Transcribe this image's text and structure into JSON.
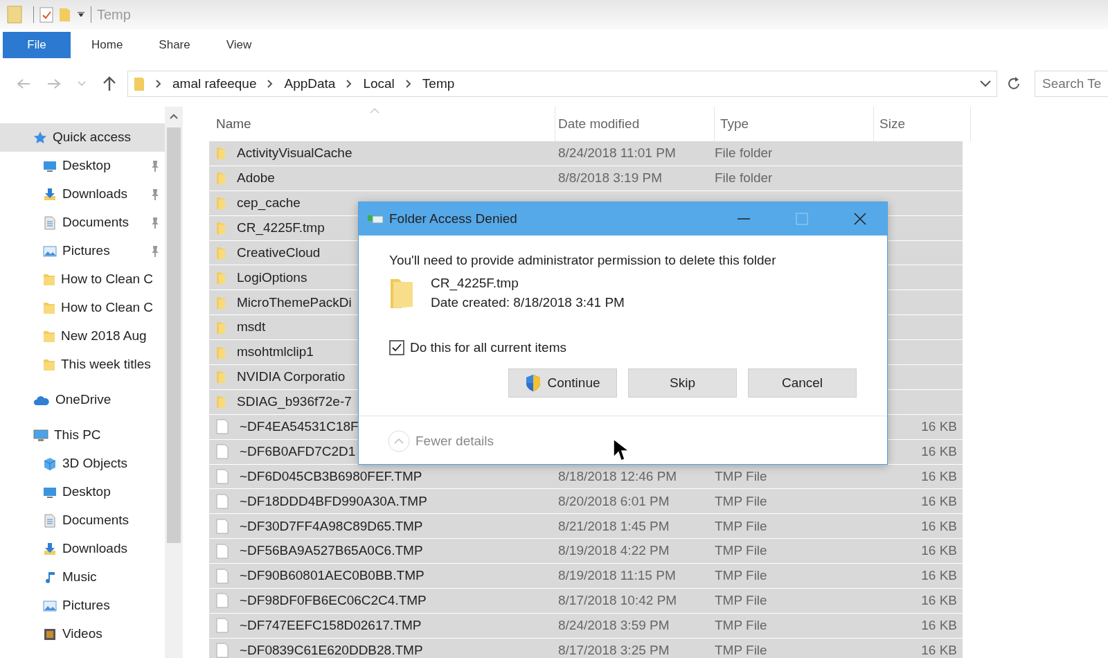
{
  "window": {
    "title": "Temp"
  },
  "ribbon_tabs": [
    {
      "label": "File",
      "selected": true
    },
    {
      "label": "Home",
      "selected": false
    },
    {
      "label": "Share",
      "selected": false
    },
    {
      "label": "View",
      "selected": false
    }
  ],
  "address_bar": {
    "path": [
      "amal rafeeque",
      "AppData",
      "Local",
      "Temp"
    ]
  },
  "search": {
    "placeholder": "Search Te"
  },
  "sidebar": {
    "items": [
      {
        "label": "Quick access",
        "kind": "star",
        "selected": true,
        "children": [
          {
            "label": "Desktop",
            "kind": "desktop",
            "selected": false,
            "pinned": true
          },
          {
            "label": "Downloads",
            "kind": "download",
            "selected": false,
            "pinned": true
          },
          {
            "label": "Documents",
            "kind": "document",
            "selected": false,
            "pinned": true
          },
          {
            "label": "Pictures",
            "kind": "picture",
            "selected": false,
            "pinned": true
          },
          {
            "label": "How to Clean C",
            "kind": "folder",
            "selected": false,
            "pinned": false
          },
          {
            "label": "How to Clean C",
            "kind": "folder",
            "selected": false,
            "pinned": false
          },
          {
            "label": "New 2018 Aug",
            "kind": "folder",
            "selected": false,
            "pinned": false
          },
          {
            "label": "This week titles",
            "kind": "folder",
            "selected": false,
            "pinned": false
          }
        ]
      },
      {
        "label": "OneDrive",
        "kind": "cloud",
        "selected": false
      },
      {
        "label": "This PC",
        "kind": "computer",
        "selected": false,
        "children": [
          {
            "label": "3D Objects",
            "kind": "cube",
            "selected": false
          },
          {
            "label": "Desktop",
            "kind": "desktop",
            "selected": false
          },
          {
            "label": "Documents",
            "kind": "document",
            "selected": false
          },
          {
            "label": "Downloads",
            "kind": "download",
            "selected": false
          },
          {
            "label": "Music",
            "kind": "music",
            "selected": false
          },
          {
            "label": "Pictures",
            "kind": "picture",
            "selected": false
          },
          {
            "label": "Videos",
            "kind": "video",
            "selected": false
          }
        ]
      }
    ]
  },
  "table": {
    "columns": [
      "Name",
      "Date modified",
      "Type",
      "Size"
    ],
    "rows": [
      {
        "kind": "folder",
        "selected": true,
        "name": "ActivityVisualCache",
        "date": "8/24/2018 11:01 PM",
        "type": "File folder"
      },
      {
        "kind": "folder",
        "selected": true,
        "name": "Adobe",
        "date": "8/8/2018 3:19 PM",
        "type": "File folder"
      },
      {
        "kind": "folder",
        "selected": true,
        "name": "cep_cache"
      },
      {
        "kind": "folder",
        "selected": true,
        "name": "CR_4225F.tmp"
      },
      {
        "kind": "folder",
        "selected": true,
        "name": "CreativeCloud"
      },
      {
        "kind": "folder",
        "selected": true,
        "name": "LogiOptions"
      },
      {
        "kind": "folder",
        "selected": true,
        "name": "MicroThemePackDi"
      },
      {
        "kind": "folder",
        "selected": true,
        "name": "msdt"
      },
      {
        "kind": "folder",
        "selected": true,
        "name": "msohtmlclip1"
      },
      {
        "kind": "folder",
        "selected": true,
        "name": "NVIDIA Corporatio"
      },
      {
        "kind": "folder",
        "selected": true,
        "name": "SDIAG_b936f72e-7"
      },
      {
        "kind": "file",
        "selected": true,
        "name": "~DF4EA54531C18F",
        "size": "16 KB"
      },
      {
        "kind": "file",
        "selected": true,
        "name": "~DF6B0AFD7C2D1",
        "size": "16 KB"
      },
      {
        "kind": "file",
        "selected": true,
        "name": "~DF6D045CB3B6980FEF.TMP",
        "date": "8/18/2018 12:46 PM",
        "type": "TMP File",
        "size": "16 KB"
      },
      {
        "kind": "file",
        "selected": true,
        "name": "~DF18DDD4BFD990A30A.TMP",
        "date": "8/20/2018 6:01 PM",
        "type": "TMP File",
        "size": "16 KB"
      },
      {
        "kind": "file",
        "selected": true,
        "name": "~DF30D7FF4A98C89D65.TMP",
        "date": "8/21/2018 1:45 PM",
        "type": "TMP File",
        "size": "16 KB"
      },
      {
        "kind": "file",
        "selected": true,
        "name": "~DF56BA9A527B65A0C6.TMP",
        "date": "8/19/2018 4:22 PM",
        "type": "TMP File",
        "size": "16 KB"
      },
      {
        "kind": "file",
        "selected": true,
        "name": "~DF90B60801AEC0B0BB.TMP",
        "date": "8/19/2018 11:15 PM",
        "type": "TMP File",
        "size": "16 KB"
      },
      {
        "kind": "file",
        "selected": true,
        "name": "~DF98DF0FB6EC06C2C4.TMP",
        "date": "8/17/2018 10:42 PM",
        "type": "TMP File",
        "size": "16 KB"
      },
      {
        "kind": "file",
        "selected": true,
        "name": "~DF747EEFC158D02617.TMP",
        "date": "8/24/2018 3:59 PM",
        "type": "TMP File",
        "size": "16 KB"
      },
      {
        "kind": "file",
        "selected": true,
        "name": "~DF0839C61E620DDB28.TMP",
        "date": "8/17/2018 3:25 PM",
        "type": "TMP File",
        "size": "16 KB"
      }
    ]
  },
  "dialog": {
    "title": "Folder Access Denied",
    "maximize": {
      "disabled": true
    },
    "message": "You'll need to provide administrator permission to delete this folder",
    "file": {
      "name": "CR_4225F.tmp",
      "date_created": "Date created: 8/18/2018 3:41 PM"
    },
    "checkbox": {
      "label": "Do this for all current items",
      "checked": true
    },
    "buttons": [
      {
        "label": "Continue",
        "kind": "elevated"
      },
      {
        "label": "Skip",
        "kind": "plain"
      },
      {
        "label": "Cancel",
        "kind": "plain"
      }
    ],
    "details_toggle": {
      "label": "Fewer details",
      "expanded": true
    }
  }
}
